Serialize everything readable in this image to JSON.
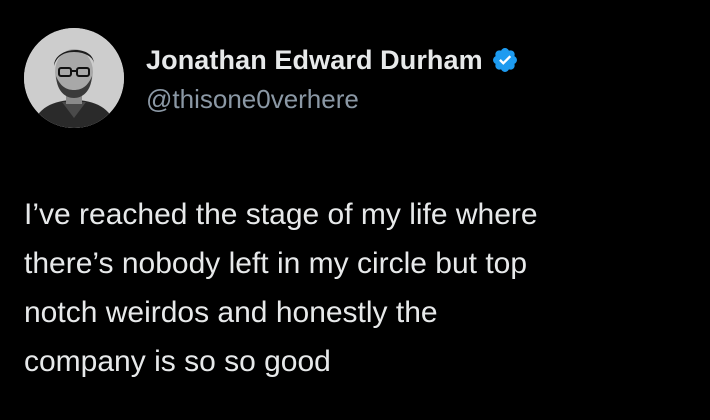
{
  "author": {
    "display_name": "Jonathan Edward Durham",
    "handle": "@thisone0verhere",
    "verified": true,
    "verified_icon": "verified-badge-icon",
    "avatar": "profile-photo-avatar"
  },
  "tweet": {
    "lines": [
      "I’ve reached the stage of my life where",
      "there’s nobody left in my circle but top",
      "notch weirdos and honestly the",
      "company is so so good"
    ]
  },
  "colors": {
    "background": "#000000",
    "text": "#e7e9ea",
    "secondary_text": "#8b98a5",
    "verified_badge": "#1d9bf0"
  }
}
